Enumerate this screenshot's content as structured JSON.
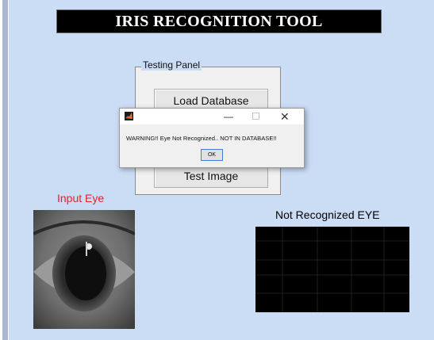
{
  "title": "IRIS RECOGNITION TOOL",
  "testing_panel": {
    "legend": "Testing Panel",
    "load_button": "Load Database",
    "test_button": "Test Image"
  },
  "dialog": {
    "minimize_symbol": "—",
    "maximize_symbol": "☐",
    "close_symbol": "✕",
    "message": "WARNING!! Eye Not Recognized.. NOT IN DATABASE!!",
    "ok_label": "OK"
  },
  "input_eye": {
    "label": "Input Eye",
    "label_color": "#e8202a"
  },
  "result": {
    "label": "Not Recognized EYE"
  },
  "colors": {
    "figure_background": "#cbdcf5",
    "title_background": "#000000",
    "title_text": "#ffffff"
  },
  "icons": {
    "dialog_app_icon": "matlab-logo-icon"
  }
}
